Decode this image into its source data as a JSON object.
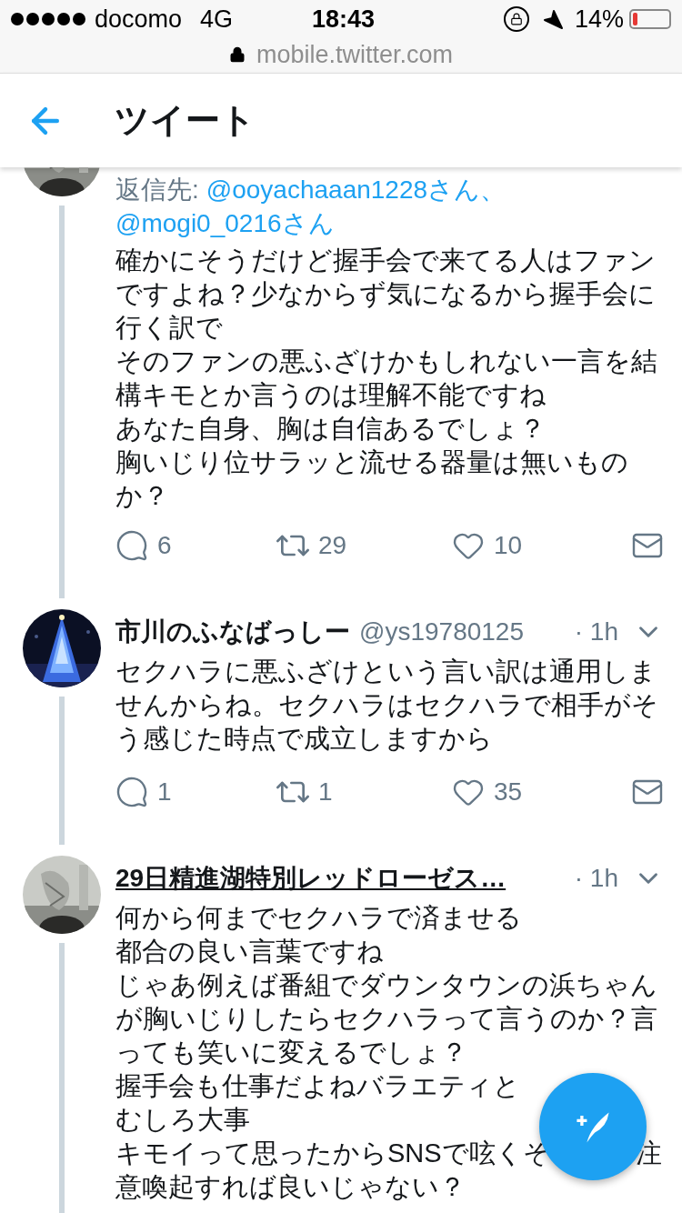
{
  "status_bar": {
    "carrier": "docomo",
    "network": "4G",
    "time": "18:43",
    "battery": "14%"
  },
  "address_bar": {
    "url": "mobile.twitter.com"
  },
  "header": {
    "title": "ツイート"
  },
  "tweets": [
    {
      "kind": "reply_context",
      "reply_label": "返信先:",
      "reply_to": [
        "@ooyachaaan1228さん、",
        "@mogi0_0216さん"
      ],
      "lines": [
        "確かにそうだけど握手会で来てる人はファン",
        "ですよね？少なからず気になるから握手会に",
        "行く訳で",
        "そのファンの悪ふざけかもしれない一言を結",
        "構キモとか言うのは理解不能ですね",
        "あなた自身、胸は自信あるでしょ？",
        "胸いじり位サラッと流せる器量は無いもの",
        "か？"
      ],
      "replies": "6",
      "retweets": "29",
      "likes": "10"
    },
    {
      "kind": "full",
      "name": "市川のふなばっしー",
      "handle": "@ys19780125",
      "time": "· 1h",
      "underlined": false,
      "lines": [
        "セクハラに悪ふざけという言い訳は通用しま",
        "せんからね。セクハラはセクハラで相手がそ",
        "う感じた時点で成立しますから"
      ],
      "replies": "1",
      "retweets": "1",
      "likes": "35"
    },
    {
      "kind": "full",
      "name": "29日精進湖特別レッドローゼス…",
      "time": "· 1h",
      "underlined": true,
      "lines": [
        "何から何までセクハラで済ませる",
        "都合の良い言葉ですね",
        "じゃあ例えば番組でダウンタウンの浜ちゃん",
        "が胸いじりしたらセクハラって言うのか？言",
        "っても笑いに変えるでしょ？",
        "握手会も仕事だよねバラエティと",
        "むしろ大事",
        [
          "キモイって思ったからSNSで呟くそ",
          "注"
        ],
        "意喚起すれば良いじゃない？"
      ]
    }
  ]
}
